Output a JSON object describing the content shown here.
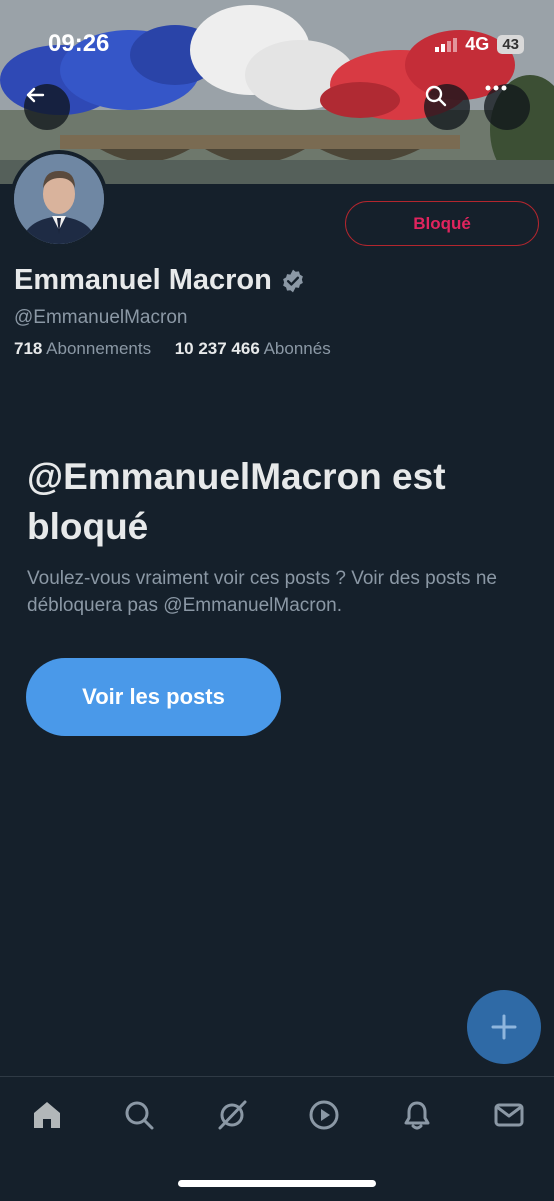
{
  "status_bar": {
    "time": "09:26",
    "network": "4G",
    "battery": "43"
  },
  "profile": {
    "name": "Emmanuel Macron",
    "handle": "@EmmanuelMacron",
    "following_count": "718",
    "following_label": "Abonnements",
    "followers_count": "10 237 466",
    "followers_label": "Abonnés",
    "blocked_label": "Bloqué",
    "verified_color": "#8b98a5"
  },
  "blocked_notice": {
    "title": "@EmmanuelMacron est bloqué",
    "body": "Voulez-vous vraiment voir ces posts ? Voir des posts ne débloquera pas @EmmanuelMacron.",
    "button": "Voir les posts"
  },
  "colors": {
    "accent": "#4a99e9",
    "blocked": "#e0245e",
    "background": "#15202b"
  },
  "icons": {
    "top_left": "back-arrow-icon",
    "top_right": [
      "search-icon",
      "more-icon"
    ],
    "fab": "compose-plus-icon",
    "tabs": [
      "home-icon",
      "search-icon",
      "grok-icon",
      "video-icon",
      "notifications-icon",
      "messages-icon"
    ]
  }
}
